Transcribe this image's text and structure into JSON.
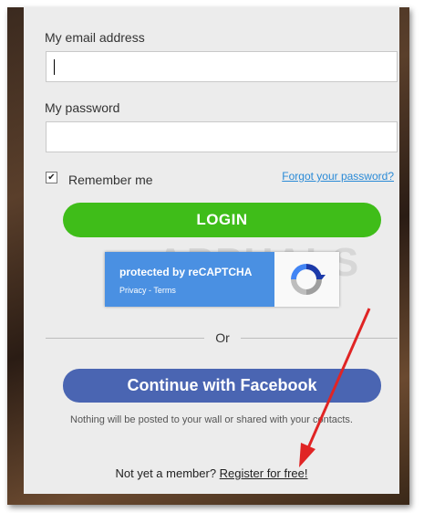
{
  "form": {
    "email_label": "My email address",
    "password_label": "My password",
    "remember_label": "Remember me",
    "remember_checked": true,
    "forgot_link": "Forgot your password?",
    "login_button": "LOGIN"
  },
  "recaptcha": {
    "title": "protected by reCAPTCHA",
    "links": "Privacy - Terms"
  },
  "divider": {
    "text": "Or"
  },
  "facebook": {
    "button": "Continue with Facebook",
    "note": "Nothing will be posted to your wall or shared with your contacts."
  },
  "footer": {
    "prompt": "Not yet a member?",
    "register_link": "Register for free!"
  },
  "watermark": {
    "text": "APPUALS"
  },
  "colors": {
    "login_green": "#3fbd19",
    "facebook_blue": "#4a65b2",
    "link_blue": "#2a8ad6",
    "annotation_red": "#e02424"
  },
  "icons": {
    "checkbox": "check-icon",
    "recaptcha": "recaptcha-logo-icon",
    "annotation": "red-arrow-icon"
  }
}
